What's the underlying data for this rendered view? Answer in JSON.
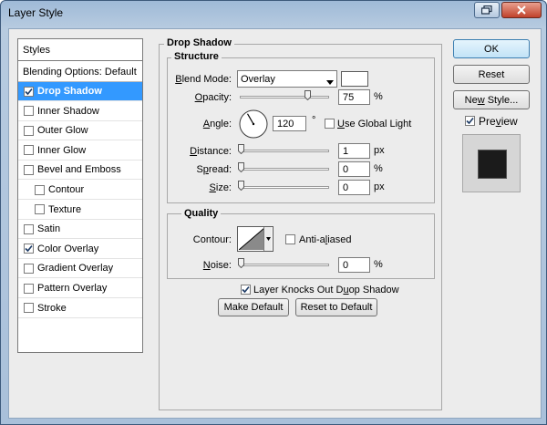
{
  "window": {
    "title": "Layer Style"
  },
  "styles": {
    "header": "Styles",
    "blending_options": "Blending Options: Default",
    "items": [
      {
        "label": "Drop Shadow",
        "checked": true,
        "selected": true
      },
      {
        "label": "Inner Shadow",
        "checked": false
      },
      {
        "label": "Outer Glow",
        "checked": false
      },
      {
        "label": "Inner Glow",
        "checked": false
      },
      {
        "label": "Bevel and Emboss",
        "checked": false
      },
      {
        "label": "Contour",
        "checked": false,
        "indent": true
      },
      {
        "label": "Texture",
        "checked": false,
        "indent": true
      },
      {
        "label": "Satin",
        "checked": false
      },
      {
        "label": "Color Overlay",
        "checked": true
      },
      {
        "label": "Gradient Overlay",
        "checked": false
      },
      {
        "label": "Pattern Overlay",
        "checked": false
      },
      {
        "label": "Stroke",
        "checked": false
      }
    ]
  },
  "drop_shadow": {
    "title": "Drop Shadow",
    "structure_title": "Structure",
    "blend_mode_label": "Blend Mode:",
    "blend_mode_value": "Overlay",
    "opacity_label": "Opacity:",
    "opacity_value": "75",
    "opacity_unit": "%",
    "opacity_fraction": 0.75,
    "angle_label": "Angle:",
    "angle_value": "120",
    "angle_unit": "°",
    "use_global_light_label": "Use Global Light",
    "use_global_light_checked": false,
    "distance_label": "Distance:",
    "distance_value": "1",
    "distance_unit": "px",
    "spread_label": "Spread:",
    "spread_value": "0",
    "spread_unit": "%",
    "size_label": "Size:",
    "size_value": "0",
    "size_unit": "px",
    "quality_title": "Quality",
    "contour_label": "Contour:",
    "anti_aliased_label": "Anti-aliased",
    "anti_aliased_checked": false,
    "noise_label": "Noise:",
    "noise_value": "0",
    "noise_unit": "%",
    "knocks_out_label": "Layer Knocks Out Drop Shadow",
    "knocks_out_checked": true,
    "make_default_label": "Make Default",
    "reset_default_label": "Reset to Default"
  },
  "actions": {
    "ok_label": "OK",
    "reset_label": "Reset",
    "new_style_label": "New Style...",
    "preview_label": "Preview",
    "preview_checked": true
  },
  "colors": {
    "selection": "#3399ff",
    "shadow_color": "#ffffff",
    "preview_swatch": "#1b1b1b"
  }
}
